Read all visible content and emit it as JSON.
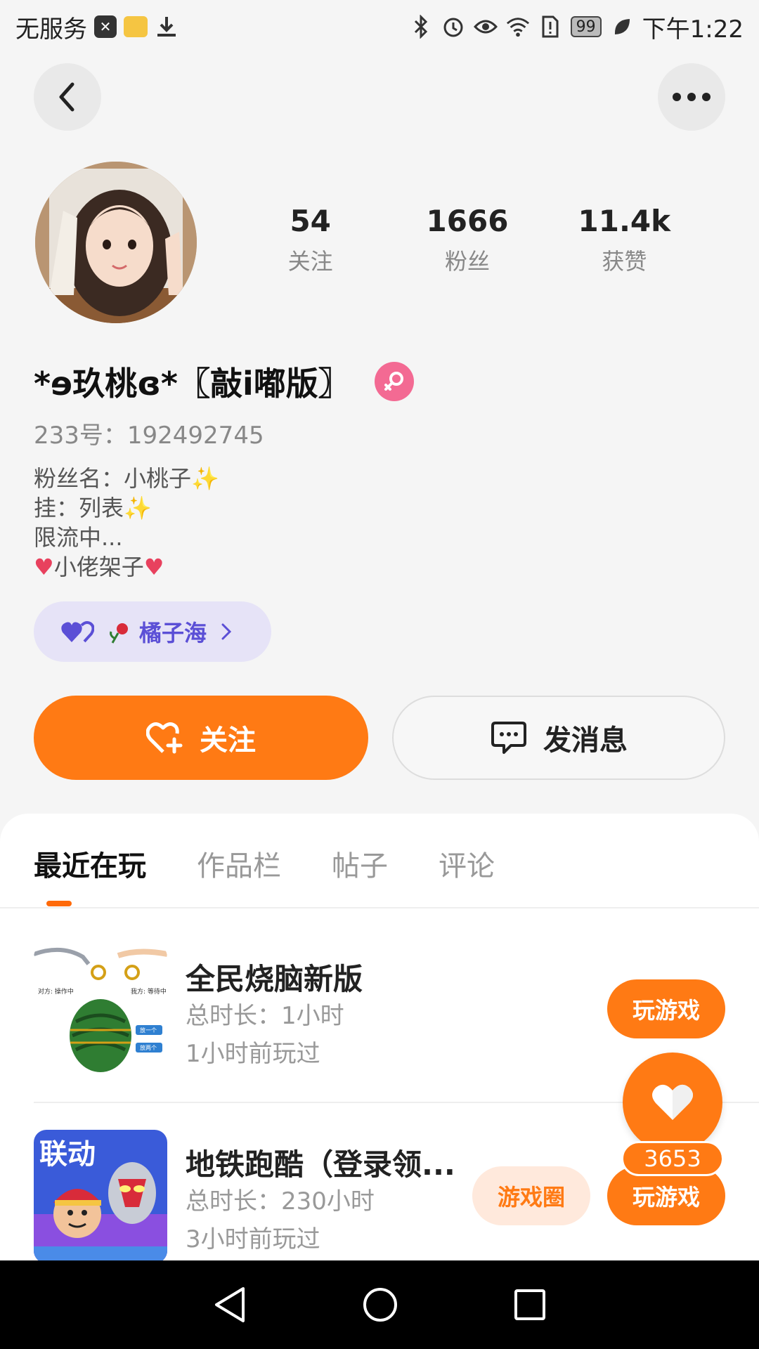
{
  "status_bar": {
    "carrier": "无服务",
    "time": "下午1:22",
    "battery": "99"
  },
  "profile": {
    "stats": [
      {
        "value": "54",
        "label": "关注"
      },
      {
        "value": "1666",
        "label": "粉丝"
      },
      {
        "value": "11.4k",
        "label": "获赞"
      }
    ],
    "name": "*ɘ玖桃ɞ*〖敲i嘟版〗",
    "uid": "233号：192492745",
    "bio": {
      "line1": "粉丝名：小桃子",
      "line2": "挂：列表",
      "line3": "限流中...",
      "line4": "小佬架子"
    },
    "fan_club": "橘子海"
  },
  "actions": {
    "follow": "关注",
    "message": "发消息"
  },
  "tabs": [
    "最近在玩",
    "作品栏",
    "帖子",
    "评论"
  ],
  "games": [
    {
      "title": "全民烧脑新版",
      "duration": "总时长：1小时",
      "last_played": "1小时前玩过",
      "play": "玩游戏",
      "thumb_left": "对方: 操作中",
      "thumb_right": "我方: 等待中",
      "thumb_btn1": "放一个",
      "thumb_btn2": "放两个"
    },
    {
      "title": "地铁跑酷（登录领...",
      "duration": "总时长：230小时",
      "last_played": "3小时前玩过",
      "circle": "游戏圈",
      "play": "玩游戏",
      "thumb_text": "联动"
    }
  ],
  "like_count": "3653"
}
